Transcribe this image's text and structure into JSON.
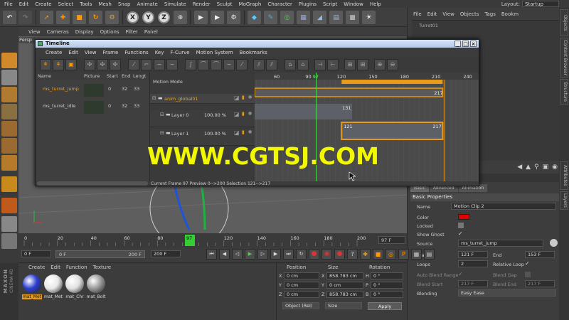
{
  "menubar": {
    "items": [
      "File",
      "Edit",
      "Create",
      "Select",
      "Tools",
      "Mesh",
      "Snap",
      "Animate",
      "Simulate",
      "Render",
      "Sculpt",
      "MoGraph",
      "Character",
      "Plugins",
      "Script",
      "Window",
      "Help"
    ],
    "layout_label": "Layout:",
    "layout_value": "Startup"
  },
  "viewport": {
    "menu": [
      "View",
      "Cameras",
      "Display",
      "Options",
      "Filter",
      "Panel"
    ],
    "tab": "Persp"
  },
  "objects": {
    "menu": [
      "File",
      "Edit",
      "View",
      "Objects",
      "Tags",
      "Bookm"
    ],
    "item": "Turret01"
  },
  "side_tabs": [
    "Objects",
    "Content Browser",
    "Structure",
    "Attributes",
    "Layers"
  ],
  "timeline": {
    "title": "Timeline",
    "menu": [
      "Create",
      "Edit",
      "View",
      "Frame",
      "Functions",
      "Key",
      "F-Curve",
      "Motion System",
      "Bookmarks"
    ],
    "columns": {
      "name": "Name",
      "picture": "Picture",
      "start": "Start",
      "end": "End",
      "length": "Lengt"
    },
    "clips": [
      {
        "name": "ms_turret_jump",
        "start": "0",
        "end": "32",
        "length": "33"
      },
      {
        "name": "ms_turret_idle",
        "start": "0",
        "end": "32",
        "length": "33"
      }
    ],
    "motion_mode": "Motion Mode",
    "layers": [
      {
        "name": "anim_global01",
        "value": ""
      },
      {
        "name": "Layer 0",
        "value": "100.00 %"
      },
      {
        "name": "Layer 1",
        "value": "100.00 %"
      }
    ],
    "ruler": [
      "60",
      "90",
      "97",
      "120",
      "150",
      "180",
      "210",
      "240"
    ],
    "bar_labels": {
      "top_end": "217",
      "layer0_end": "131",
      "layer1_start": "121",
      "layer1_end": "217"
    },
    "status": "Current Frame  97  Preview  0-->200    Selection 121-->217"
  },
  "watermark": "WWW.CGTSJ.COM",
  "timebar": {
    "ticks": [
      "0",
      "20",
      "40",
      "60",
      "80",
      "97",
      "120",
      "140",
      "160",
      "180",
      "200"
    ],
    "current": "97",
    "current_field": "97 F"
  },
  "transport": {
    "start": "0 F",
    "range_start": "0 F",
    "range_end": "200 F",
    "end": "200 F"
  },
  "materials": {
    "menu": [
      "Create",
      "Edit",
      "Function",
      "Texture"
    ],
    "items": [
      {
        "label": "mat_Met",
        "color": "#2c3fd0"
      },
      {
        "label": "mat_Met",
        "color": "#e8e8e8"
      },
      {
        "label": "mat_Chr",
        "color": "#e0e0e0"
      },
      {
        "label": "mat_Bolt",
        "color": "#9a9a9a"
      }
    ]
  },
  "maxon": {
    "brand": "MAXON",
    "product": "CINEMA 4D"
  },
  "coords": {
    "headers": {
      "position": "Position",
      "size": "Size",
      "rotation": "Rotation"
    },
    "rows": [
      {
        "axis": "X",
        "pos": "0 cm",
        "size_axis": "X",
        "size": "858.783 cm",
        "rot_axis": "H",
        "rot": "0 °"
      },
      {
        "axis": "Y",
        "pos": "0 cm",
        "size_axis": "Y",
        "size": "0 cm",
        "rot_axis": "P",
        "rot": "0 °"
      },
      {
        "axis": "Z",
        "pos": "0 cm",
        "size_axis": "Z",
        "size": "858.783 cm",
        "rot_axis": "B",
        "rot": "0 °"
      }
    ],
    "mode": "Object (Rel)",
    "size_mode": "Size",
    "apply": "Apply"
  },
  "attributes": {
    "menu": [
      "Mode",
      "Edit",
      "User Data"
    ],
    "tabs": [
      "Basic",
      "Advanced",
      "Animation"
    ],
    "section": "Basic Properties",
    "name_label": "Name",
    "name_value": "Motion Clip 2",
    "color_label": "Color",
    "color_value": "#e00000",
    "locked_label": "Locked",
    "show_ghost_label": "Show Ghost",
    "source_label": "Source",
    "source_value": "ms_turret_jump",
    "start_label": "Start",
    "start_value": "121 F",
    "end_label": "End",
    "end_value": "153 F",
    "loops_label": "Loops",
    "loops_value": "2",
    "relative_loop_label": "Relative Loop",
    "auto_blend_label": "Auto Blend Range",
    "blend_gap_label": "Blend Gap",
    "blend_start_label": "Blend Start",
    "blend_start_value": "217 F",
    "blend_end_label": "Blend End",
    "blend_end_value": "217 F",
    "blending_label": "Blending",
    "blending_value": "Easy Ease"
  }
}
